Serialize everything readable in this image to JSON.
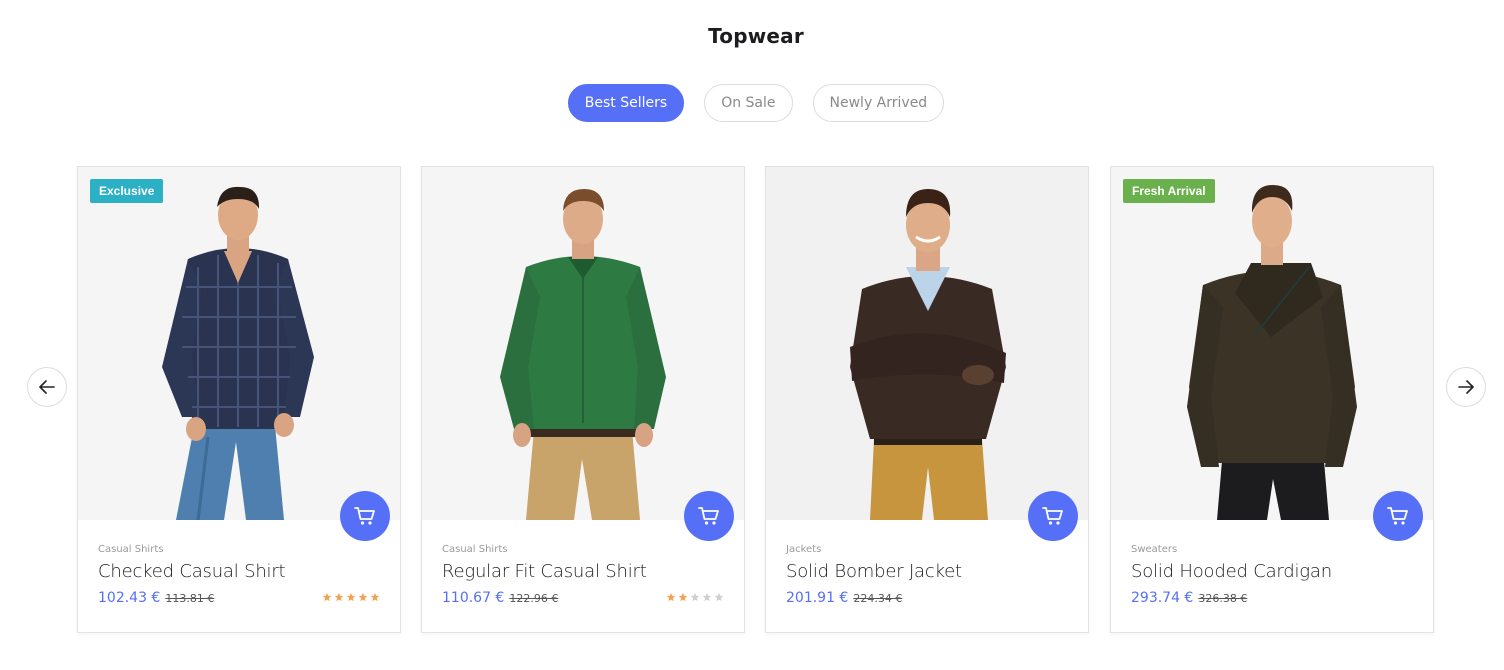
{
  "section": {
    "title": "Topwear"
  },
  "tabs": [
    {
      "label": "Best Sellers",
      "active": true
    },
    {
      "label": "On Sale",
      "active": false
    },
    {
      "label": "Newly Arrived",
      "active": false
    }
  ],
  "navigation": {
    "prev_icon": "arrow-left-icon",
    "next_icon": "arrow-right-icon"
  },
  "colors": {
    "accent": "#556ff7",
    "badge_exclusive": "#2bb0c6",
    "badge_fresh": "#6ab04c",
    "star_on": "#f5a353",
    "star_off": "#cfcfcf"
  },
  "products": [
    {
      "badge": "Exclusive",
      "category": "Casual Shirts",
      "name": "Checked Casual Shirt",
      "price": "102.43 €",
      "old_price": "113.81 €",
      "rating": 5,
      "cart_icon": "cart-icon"
    },
    {
      "badge": "",
      "category": "Casual Shirts",
      "name": "Regular Fit Casual Shirt",
      "price": "110.67 €",
      "old_price": "122.96 €",
      "rating": 2,
      "cart_icon": "cart-icon"
    },
    {
      "badge": "",
      "category": "Jackets",
      "name": "Solid Bomber Jacket",
      "price": "201.91 €",
      "old_price": "224.34 €",
      "rating": 0,
      "cart_icon": "cart-icon"
    },
    {
      "badge": "Fresh Arrival",
      "category": "Sweaters",
      "name": "Solid Hooded Cardigan",
      "price": "293.74 €",
      "old_price": "326.38 €",
      "rating": 0,
      "cart_icon": "cart-icon"
    }
  ]
}
